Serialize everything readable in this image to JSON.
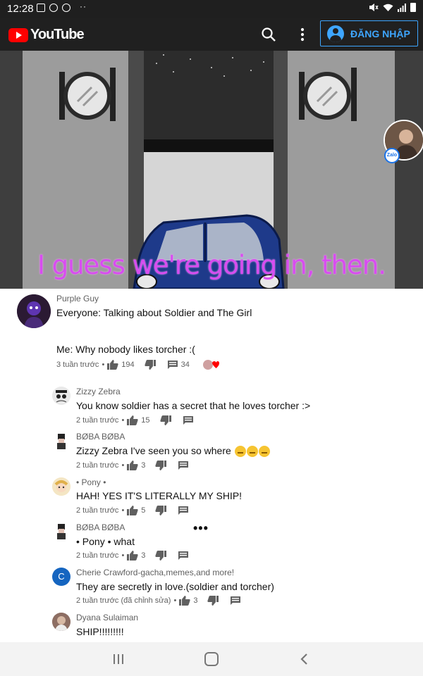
{
  "status_bar": {
    "time": "12:28",
    "dots": "··"
  },
  "header": {
    "logo_text": "YouTube",
    "signin_label": "ĐĂNG NHẬP"
  },
  "video": {
    "caption": "I guess we're going in, then.",
    "overlay_badge": "Zalo"
  },
  "comments": [
    {
      "author": "Purple Guy",
      "text_lines": [
        "Everyone: Talking about Soldier and The Girl",
        "Me: Why nobody likes torcher :("
      ],
      "time": "3 tuần trước",
      "likes": "194",
      "replies": "34",
      "avatar_color": "#2b1a33"
    },
    {
      "author": "Zizzy Zebra",
      "text": "You know soldier has a secret that he loves torcher :>",
      "time": "2 tuần trước",
      "likes": "15",
      "avatar_color": "#e9e9e9"
    },
    {
      "author": "BØBA BØBA",
      "text": "Zizzy Zebra I've seen you so where",
      "time": "2 tuần trước",
      "likes": "3",
      "avatar_color": "#ffffff"
    },
    {
      "author": "• Pony •",
      "text": "HAH! YES IT'S LITERALLY MY SHIP!",
      "time": "2 tuần trước",
      "likes": "5",
      "avatar_color": "#f4e6c4"
    },
    {
      "author": "BØBA BØBA",
      "text": "• Pony • what",
      "time": "2 tuần trước",
      "likes": "3",
      "avatar_color": "#ffffff"
    },
    {
      "author": "Cherie Crawford-gacha,memes,and more!",
      "text": "They are secretly in love.(soldier and torcher)",
      "time": "2 tuần trước (đã chỉnh sửa)",
      "likes": "3",
      "avatar_letter": "C",
      "avatar_color": "#1565c0"
    },
    {
      "author": "Dyana Sulaiman",
      "text": "SHIP!!!!!!!!!",
      "avatar_color": "#8d6e63"
    }
  ],
  "more_indicator": "•••",
  "colors": {
    "accent": "#3ea6ff",
    "brand": "#ff0000",
    "caption": "#d84cf0"
  }
}
